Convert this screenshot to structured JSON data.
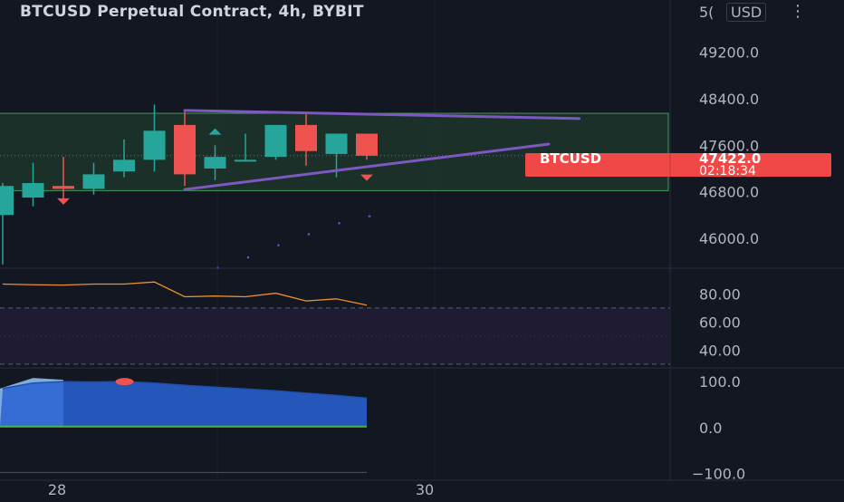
{
  "title": "BTCUSD Perpetual Contract, 4h, BYBIT",
  "currency": "USD",
  "icons": {
    "menu": "vertical-dots-icon"
  },
  "colors": {
    "background": "#131722",
    "bull": "#26a69a",
    "bear": "#ef5350",
    "trendline": "#7e57c2",
    "zone_fill": "#1f3a2c",
    "zone_border": "#3f9c5a",
    "osc_line": "#f0902a",
    "osc_band": "#1e1b33",
    "hist_fill": "#2962d4",
    "hist_light": "#90c8f8",
    "hist_zero": "#4caf50",
    "price_tag": "#f04747"
  },
  "chart_data": [
    {
      "type": "candlestick",
      "title": "BTCUSD Perpetual Contract, 4h, BYBIT",
      "timeframe": "4h",
      "y_ticks": [
        "49200.0",
        "48400.0",
        "47600.0",
        "46800.0",
        "46000.0"
      ],
      "top_tick_partial": "5(",
      "ylim": [
        45500,
        50100
      ],
      "candles": [
        {
          "o": 46400,
          "h": 46950,
          "l": 45550,
          "c": 46900
        },
        {
          "o": 46700,
          "h": 47300,
          "l": 46550,
          "c": 46950
        },
        {
          "o": 46900,
          "h": 47400,
          "l": 46650,
          "c": 46850
        },
        {
          "o": 46850,
          "h": 47300,
          "l": 46750,
          "c": 47100
        },
        {
          "o": 47150,
          "h": 47700,
          "l": 47050,
          "c": 47350
        },
        {
          "o": 47350,
          "h": 48300,
          "l": 47150,
          "c": 47850
        },
        {
          "o": 47950,
          "h": 48200,
          "l": 46900,
          "c": 47100
        },
        {
          "o": 47200,
          "h": 47600,
          "l": 47000,
          "c": 47400
        },
        {
          "o": 47350,
          "h": 47800,
          "l": 47350,
          "c": 47350
        },
        {
          "o": 47400,
          "h": 47950,
          "l": 47350,
          "c": 47950
        },
        {
          "o": 47950,
          "h": 48150,
          "l": 47250,
          "c": 47500
        },
        {
          "o": 47450,
          "h": 47800,
          "l": 47050,
          "c": 47800
        },
        {
          "o": 47800,
          "h": 47800,
          "l": 47350,
          "c": 47420
        }
      ],
      "support_zone": [
        46820,
        48150
      ],
      "trendlines": [
        {
          "from": {
            "bar": 6,
            "price": 48200
          },
          "to": {
            "bar": 19,
            "price": 48060
          }
        },
        {
          "from": {
            "bar": 6,
            "price": 46840
          },
          "to": {
            "bar": 18,
            "price": 47620
          }
        }
      ],
      "signals": [
        {
          "bar": 2,
          "price": 46640,
          "dir": "down"
        },
        {
          "bar": 7,
          "price": 47830,
          "dir": "up"
        },
        {
          "bar": 12,
          "price": 47050,
          "dir": "down"
        }
      ],
      "dots": [
        [
          7,
          45490
        ],
        [
          8,
          45670
        ],
        [
          9,
          45880
        ],
        [
          10,
          46070
        ],
        [
          11,
          46260
        ],
        [
          12,
          46380
        ]
      ],
      "last_price_label": "BTCUSD",
      "last_price": "47422.0",
      "countdown": "02:18:34",
      "x_ticks": [
        "28",
        "30"
      ]
    },
    {
      "type": "line",
      "name": "oscillator",
      "y_ticks": [
        "80.00",
        "60.00",
        "40.00"
      ],
      "ylim": [
        28,
        97
      ],
      "band": [
        30,
        70
      ],
      "values": [
        87,
        86.5,
        86.3,
        87,
        87,
        88.5,
        78,
        78.5,
        78,
        80.5,
        75,
        76.5,
        72
      ]
    },
    {
      "type": "area",
      "name": "histogram",
      "y_ticks": [
        "100.0",
        "0.0",
        "−100.0"
      ],
      "ylim": [
        -115,
        128
      ],
      "values": [
        85,
        97,
        100,
        99,
        100,
        97,
        92,
        88,
        84,
        80,
        75,
        70,
        64
      ],
      "base": 2,
      "lower_line": -98,
      "marker_bar": 5
    }
  ]
}
